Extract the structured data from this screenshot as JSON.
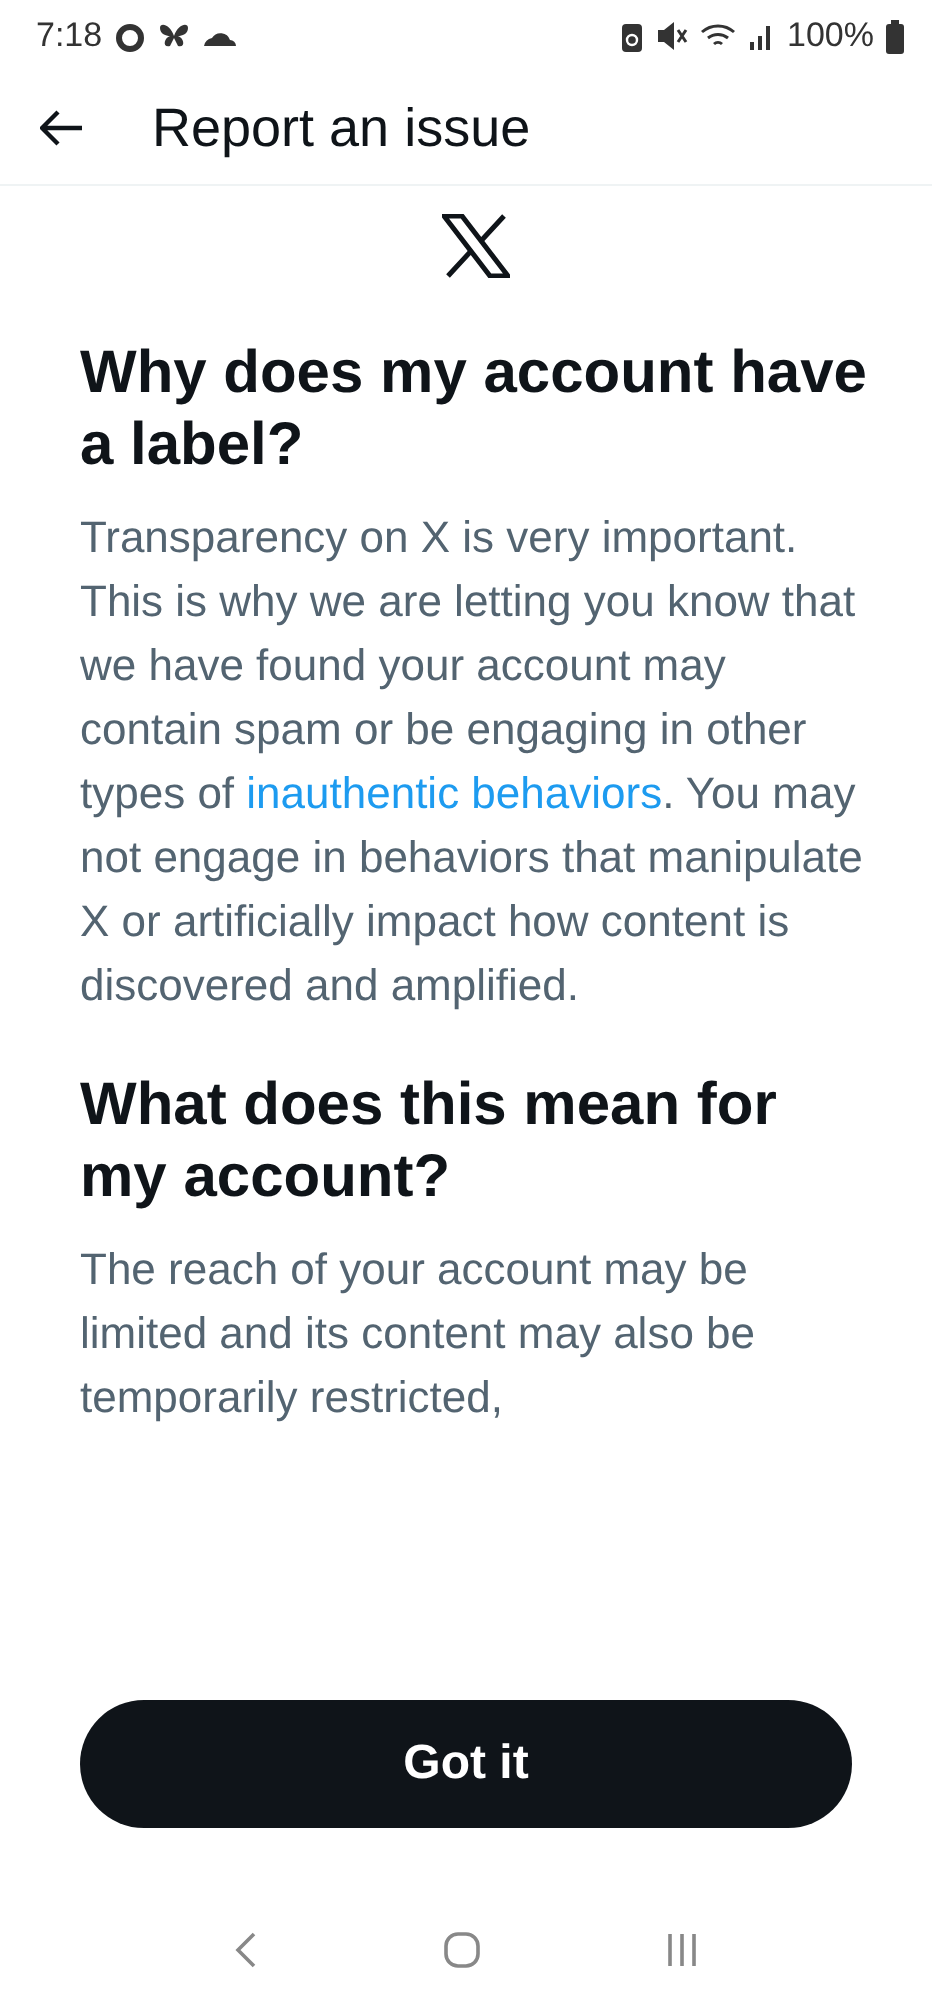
{
  "status_bar": {
    "time": "7:18",
    "battery": "100%"
  },
  "header": {
    "title": "Report an issue"
  },
  "sections": [
    {
      "heading": "Why does my account have a label?",
      "before": "Transparency on X is very important. This is why we are letting you know that we have found your account may contain spam or be engaging in other types of ",
      "link": "inauthentic behaviors",
      "after": ". You may not engage in behaviors that manipulate X or artificially impact how content is discovered and amplified."
    },
    {
      "heading": "What does this mean for my account?",
      "before": "The reach of your account may be limited and its content may also be temporarily restricted,"
    }
  ],
  "button": {
    "label": "Got it"
  }
}
